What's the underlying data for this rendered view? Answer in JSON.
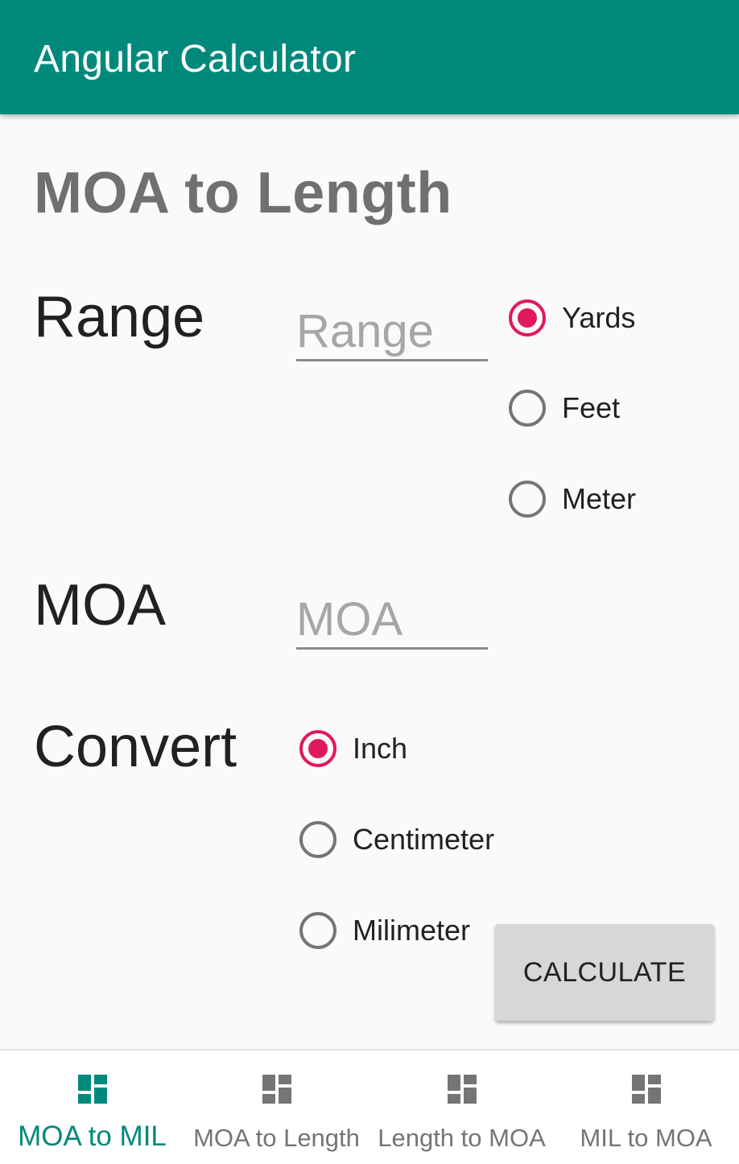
{
  "app_bar": {
    "title": "Angular Calculator",
    "color": "#00897b"
  },
  "screen": {
    "title": "MOA to Length"
  },
  "range": {
    "label": "Range",
    "placeholder": "Range",
    "units": [
      {
        "label": "Yards",
        "checked": true
      },
      {
        "label": "Feet",
        "checked": false
      },
      {
        "label": "Meter",
        "checked": false
      }
    ]
  },
  "moa": {
    "label": "MOA",
    "placeholder": "MOA"
  },
  "convert": {
    "label": "Convert",
    "units": [
      {
        "label": "Inch",
        "checked": true
      },
      {
        "label": "Centimeter",
        "checked": false
      },
      {
        "label": "Milimeter",
        "checked": false
      }
    ]
  },
  "calculate_button": {
    "label": "CALCULATE"
  },
  "bottom_nav": {
    "items": [
      {
        "label": "MOA to MIL",
        "icon": "dashboard-icon",
        "active": true
      },
      {
        "label": "MOA to Length",
        "icon": "dashboard-icon",
        "active": false
      },
      {
        "label": "Length to MOA",
        "icon": "dashboard-icon",
        "active": false
      },
      {
        "label": "MIL to MOA",
        "icon": "dashboard-icon",
        "active": false
      }
    ]
  },
  "colors": {
    "primary": "#00897b",
    "accent": "#e0195e",
    "inactive": "#757575"
  }
}
